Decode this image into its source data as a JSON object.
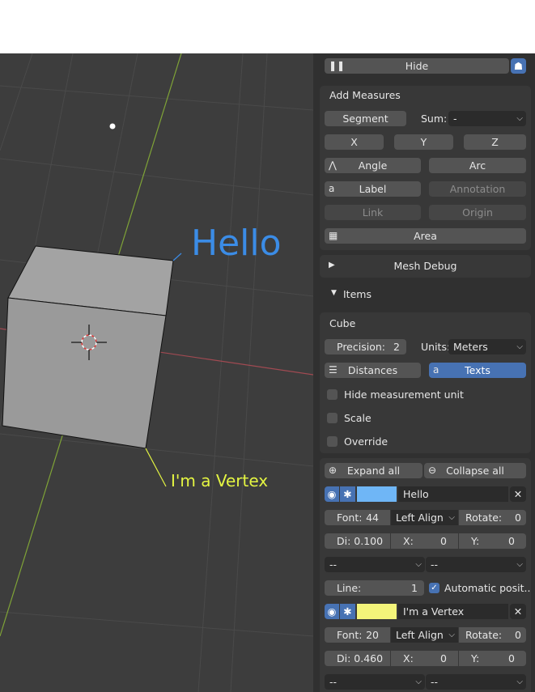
{
  "viewport": {
    "hello_text": "Hello",
    "vertex_text": "I'm a Vertex",
    "colors": {
      "background": "#3d3d3d",
      "grid": "#4c4c4c",
      "x_axis": "#a14a52",
      "y_axis": "#7fa337",
      "cube_face": "#9e9e9e",
      "hello": "#3b8ce6",
      "vertex": "#e4f542"
    }
  },
  "panel": {
    "hide_label": "Hide",
    "add_measures": {
      "title": "Add Measures",
      "segment": "Segment",
      "sum_label": "Sum:",
      "sum_value": "-",
      "x": "X",
      "y": "Y",
      "z": "Z",
      "angle": "Angle",
      "arc": "Arc",
      "label": "Label",
      "annotation": "Annotation",
      "link": "Link",
      "origin": "Origin",
      "area": "Area"
    },
    "mesh_debug": "Mesh Debug",
    "items_header": "Items",
    "cube": {
      "title": "Cube",
      "precision_label": "Precision:",
      "precision_value": "2",
      "units_label": "Units:",
      "units_value": "Meters",
      "distances": "Distances",
      "texts": "Texts",
      "hide_unit": "Hide measurement unit",
      "scale": "Scale",
      "override": "Override"
    },
    "list": {
      "expand_all": "Expand all",
      "collapse_all": "Collapse all",
      "items": [
        {
          "name": "Hello",
          "color": "#6fb6f6",
          "font_label": "Font:",
          "font_value": "44",
          "align": "Left Align",
          "rotate_label": "Rotate:",
          "rotate_value": "0",
          "di": "Di: 0.100",
          "x_label": "X:",
          "x_value": "0",
          "y_label": "Y:",
          "y_value": "0",
          "drop_a": "--",
          "drop_b": "--",
          "line_label": "Line:",
          "line_value": "1",
          "auto_pos": "Automatic posit.."
        },
        {
          "name": "I'm a Vertex",
          "color": "#f4f57a",
          "font_label": "Font:",
          "font_value": "20",
          "align": "Left Align",
          "rotate_label": "Rotate:",
          "rotate_value": "0",
          "di": "Di: 0.460",
          "x_label": "X:",
          "x_value": "0",
          "y_label": "Y:",
          "y_value": "0",
          "drop_a": "--",
          "drop_b": "--"
        }
      ]
    }
  }
}
